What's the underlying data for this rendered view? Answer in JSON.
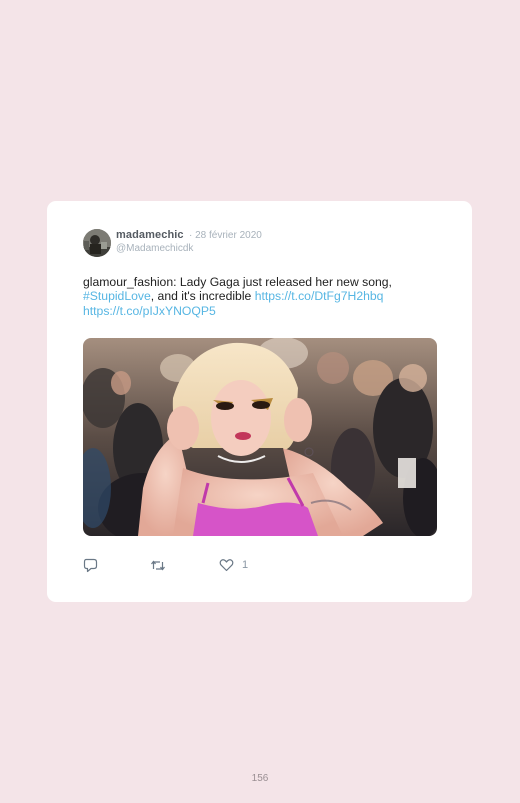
{
  "tweet": {
    "user_name": "madamechic",
    "date": "· 28 février 2020",
    "handle": "@Madamechicdk",
    "text_part1": "glamour_fashion: Lady Gaga just released her new song, ",
    "hashtag": "#StupidLove",
    "text_part2": ", and it's incredible ",
    "link1": "https://t.co/DtFg7H2hbq",
    "link2": "https://t.co/pIJxYNOQP5",
    "like_count": "1"
  },
  "icons": {
    "reply": "reply-icon",
    "retweet": "retweet-icon",
    "like": "heart-icon"
  },
  "colors": {
    "page_background": "#f4e4e8",
    "card_background": "#ffffff",
    "link": "#57b6e3",
    "muted": "#a8b2bb"
  },
  "page": {
    "number": "156"
  }
}
